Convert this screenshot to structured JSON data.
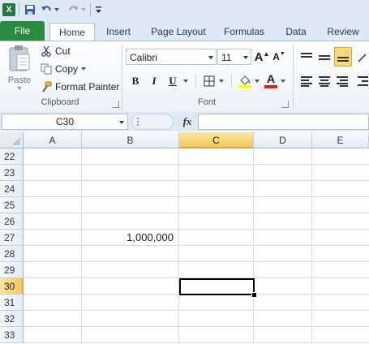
{
  "quick_access": {
    "app_icon": "X",
    "icons": [
      "excel-icon",
      "save-icon",
      "undo-icon",
      "redo-icon",
      "customize-qat-icon"
    ]
  },
  "tabs": [
    {
      "label": "File"
    },
    {
      "label": "Home"
    },
    {
      "label": "Insert"
    },
    {
      "label": "Page Layout"
    },
    {
      "label": "Formulas"
    },
    {
      "label": "Data"
    },
    {
      "label": "Review"
    }
  ],
  "clipboard": {
    "paste_label": "Paste",
    "cut_label": "Cut",
    "copy_label": "Copy",
    "format_painter_label": "Format Painter",
    "group_label": "Clipboard"
  },
  "font": {
    "font_name": "Calibri",
    "font_size": "11",
    "bold_label": "B",
    "italic_label": "I",
    "underline_label": "U",
    "font_color_label": "A",
    "group_label": "Font"
  },
  "formula_bar": {
    "name_box": "C30",
    "fx_label": "fx",
    "formula_value": ""
  },
  "grid": {
    "columns": [
      "A",
      "B",
      "C",
      "D",
      "E"
    ],
    "selected_column": "C",
    "rows": [
      "22",
      "23",
      "24",
      "25",
      "26",
      "27",
      "28",
      "29",
      "30",
      "31",
      "32",
      "33"
    ],
    "selected_row": "30",
    "cells": {
      "B27": "1,000,000"
    }
  },
  "colors": {
    "file_tab": "#2a8a3e",
    "selection_header": "#f5c85a",
    "ribbon_bg": "#dfe9f5"
  }
}
